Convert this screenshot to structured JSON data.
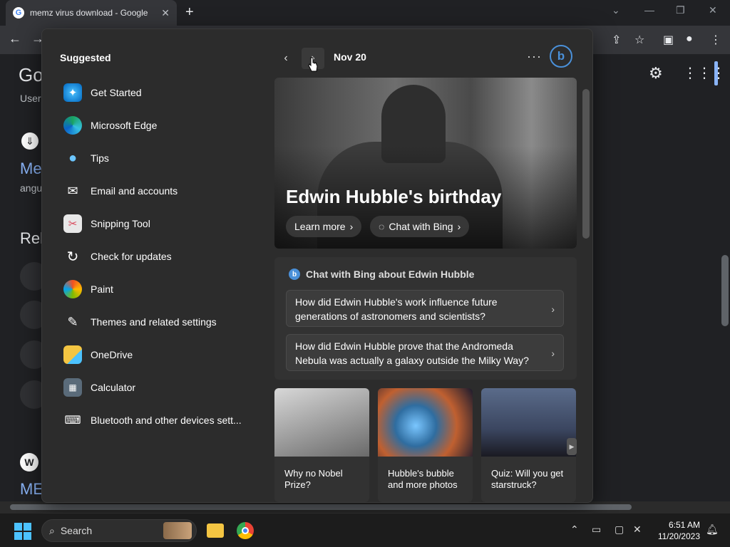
{
  "browser": {
    "tab_title": "memz virus download - Google",
    "new_tab_glyph": "+",
    "page_logo_fragment": "Go",
    "page_fragments": {
      "user": "User",
      "me1": "Me",
      "angu": "angu",
      "rel": "Rel",
      "me2": "ME"
    }
  },
  "flyout": {
    "suggested_title": "Suggested",
    "apps": [
      {
        "label": "Get Started",
        "icon": "get-started-icon"
      },
      {
        "label": "Microsoft Edge",
        "icon": "edge-icon"
      },
      {
        "label": "Tips",
        "icon": "tips-icon"
      },
      {
        "label": "Email and accounts",
        "icon": "mail-icon"
      },
      {
        "label": "Snipping Tool",
        "icon": "snipping-tool-icon"
      },
      {
        "label": "Check for updates",
        "icon": "refresh-icon"
      },
      {
        "label": "Paint",
        "icon": "paint-icon"
      },
      {
        "label": "Themes and related settings",
        "icon": "brush-icon"
      },
      {
        "label": "OneDrive",
        "icon": "onedrive-icon"
      },
      {
        "label": "Calculator",
        "icon": "calculator-icon"
      },
      {
        "label": "Bluetooth and other devices sett...",
        "icon": "bluetooth-devices-icon"
      }
    ],
    "date": "Nov 20",
    "more_glyph": "···",
    "hero": {
      "title": "Edwin Hubble's birthday",
      "learn_more": "Learn more",
      "chat_with_bing": "Chat with Bing"
    },
    "bing_card": {
      "heading": "Chat with Bing about Edwin Hubble",
      "questions": [
        "How did Edwin Hubble's work influence future generations of astronomers and scientists?",
        "How did Edwin Hubble prove that the Andromeda Nebula was actually a galaxy outside the Milky Way?"
      ]
    },
    "tiles": [
      {
        "caption": "Why no Nobel Prize?",
        "img_color": "#8a8a8a"
      },
      {
        "caption": "Hubble's bubble and more photos",
        "img_color": "#3a6f9a"
      },
      {
        "caption": "Quiz: Will you get starstruck?",
        "img_color": "#3b4660"
      }
    ]
  },
  "taskbar": {
    "search_label": "Search",
    "time": "6:51 AM",
    "date": "11/20/2023"
  },
  "colors": {
    "accent": "#4cc2ff",
    "bing_blue": "#4a90d9",
    "link_blue": "#8ab4f8"
  }
}
